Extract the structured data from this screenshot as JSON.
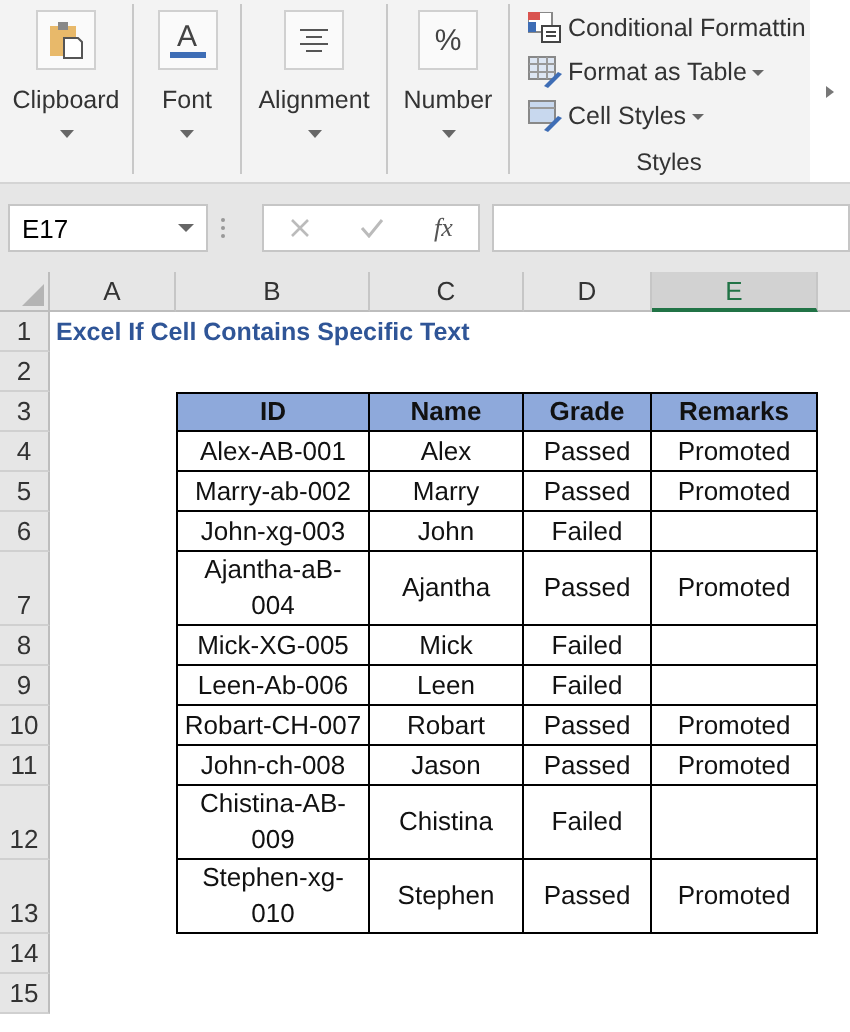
{
  "ribbon": {
    "groups": [
      {
        "kind": "clipboard",
        "label": "Clipboard"
      },
      {
        "kind": "glyph",
        "glyph": "A",
        "label": "Font"
      },
      {
        "kind": "align",
        "label": "Alignment"
      },
      {
        "kind": "glyph",
        "glyph": "%",
        "label": "Number"
      }
    ],
    "styles": {
      "items": [
        {
          "kind": "conditional",
          "label": "Conditional Formattin",
          "dropdown": false
        },
        {
          "kind": "table",
          "label": "Format as Table",
          "dropdown": true
        },
        {
          "kind": "cell",
          "label": "Cell Styles",
          "dropdown": true
        }
      ],
      "label": "Styles"
    }
  },
  "formula_bar": {
    "name_box": "E17",
    "function_label": "fx"
  },
  "columns": [
    {
      "label": "A",
      "selected": false
    },
    {
      "label": "B",
      "selected": false
    },
    {
      "label": "C",
      "selected": false
    },
    {
      "label": "D",
      "selected": false
    },
    {
      "label": "E",
      "selected": true
    }
  ],
  "rows": [
    {
      "number": "1",
      "kind": "title",
      "text": "Excel If Cell Contains Specific Text"
    },
    {
      "number": "2",
      "kind": "blank"
    },
    {
      "number": "3",
      "kind": "header",
      "cells": [
        "ID",
        "Name",
        "Grade",
        "Remarks"
      ]
    },
    {
      "number": "4",
      "kind": "record",
      "cells": [
        "Alex-AB-001",
        "Alex",
        "Passed",
        "Promoted"
      ]
    },
    {
      "number": "5",
      "kind": "record",
      "cells": [
        "Marry-ab-002",
        "Marry",
        "Passed",
        "Promoted"
      ]
    },
    {
      "number": "6",
      "kind": "record",
      "cells": [
        "John-xg-003",
        "John",
        "Failed"
      ]
    },
    {
      "number": "7",
      "kind": "record",
      "cells": [
        "Ajantha-aB-004",
        "Ajantha",
        "Passed",
        "Promoted"
      ]
    },
    {
      "number": "8",
      "kind": "record",
      "cells": [
        "Mick-XG-005",
        "Mick",
        "Failed"
      ]
    },
    {
      "number": "9",
      "kind": "record",
      "cells": [
        "Leen-Ab-006",
        "Leen",
        "Failed"
      ]
    },
    {
      "number": "10",
      "kind": "record",
      "cells": [
        "Robart-CH-007",
        "Robart",
        "Passed",
        "Promoted"
      ]
    },
    {
      "number": "11",
      "kind": "record",
      "cells": [
        "John-ch-008",
        "Jason",
        "Passed",
        "Promoted"
      ]
    },
    {
      "number": "12",
      "kind": "record",
      "cells": [
        "Chistina-AB-009",
        "Chistina",
        "Failed"
      ]
    },
    {
      "number": "13",
      "kind": "record",
      "cells": [
        "Stephen-xg-010",
        "Stephen",
        "Passed",
        "Promoted"
      ]
    },
    {
      "number": "14",
      "kind": "blank"
    },
    {
      "number": "15",
      "kind": "blank"
    }
  ]
}
